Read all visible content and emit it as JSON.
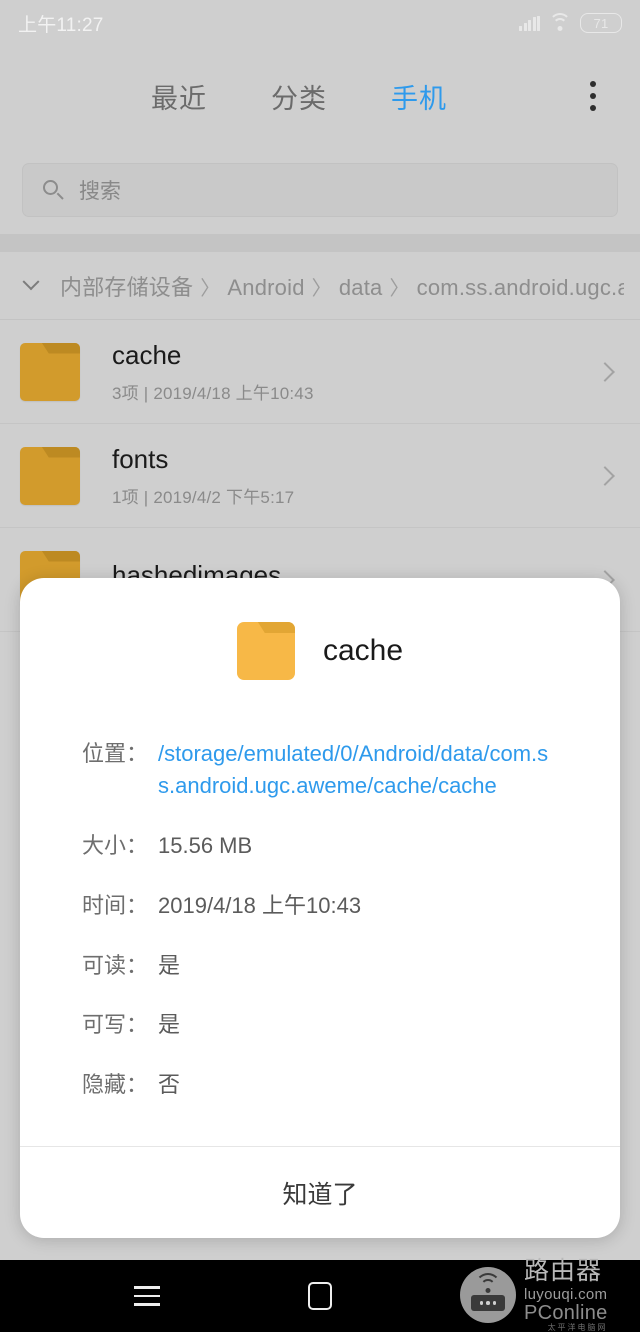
{
  "statusbar": {
    "time": "上午11:27",
    "signal_icon": "cellular-signal-icon",
    "wifi_icon": "wifi-icon",
    "battery_level": "71"
  },
  "topbar": {
    "tabs": [
      {
        "label": "最近",
        "active": false
      },
      {
        "label": "分类",
        "active": false
      },
      {
        "label": "手机",
        "active": true
      }
    ],
    "overflow_icon": "overflow-menu-icon",
    "active_color": "#2e9aec"
  },
  "search": {
    "icon": "search-icon",
    "placeholder": "搜索",
    "value": ""
  },
  "breadcrumb": {
    "collapse_icon": "chevron-down-icon",
    "segments": [
      "内部存储设备",
      "Android",
      "data",
      "com.ss.android.ugc.aweme"
    ],
    "separator": "〉"
  },
  "filelist": [
    {
      "icon": "folder-icon",
      "name": "cache",
      "subtitle": "3项 | 2019/4/18 上午10:43",
      "chevron": "chevron-right-icon"
    },
    {
      "icon": "folder-icon",
      "name": "fonts",
      "subtitle": "1项 | 2019/4/2 下午5:17",
      "chevron": "chevron-right-icon"
    },
    {
      "icon": "folder-icon",
      "name": "hashedimages",
      "subtitle": "",
      "chevron": "chevron-right-icon"
    }
  ],
  "dialog": {
    "icon": "folder-icon",
    "title": "cache",
    "details": [
      {
        "label": "位置：",
        "value": "/storage/emulated/0/Android/data/com.ss.android.ugc.aweme/cache/cache",
        "is_link": true
      },
      {
        "label": "大小：",
        "value": "15.56 MB",
        "is_link": false
      },
      {
        "label": "时间：",
        "value": "2019/4/18 上午10:43",
        "is_link": false
      },
      {
        "label": "可读：",
        "value": "是",
        "is_link": false
      },
      {
        "label": "可写：",
        "value": "是",
        "is_link": false
      },
      {
        "label": "隐藏：",
        "value": "否",
        "is_link": false
      }
    ],
    "ok_label": "知道了",
    "link_color": "#2e9aec"
  },
  "navbar": {
    "menu_icon": "nav-menu-icon",
    "home_icon": "nav-home-icon",
    "back_icon": "nav-back-icon"
  },
  "watermark": {
    "logo_icon": "router-logo-icon",
    "brand_cn": "路由器",
    "url": "luyouqi.com",
    "publisher": "PConline",
    "publisher_sub": "太平洋电脑网"
  }
}
